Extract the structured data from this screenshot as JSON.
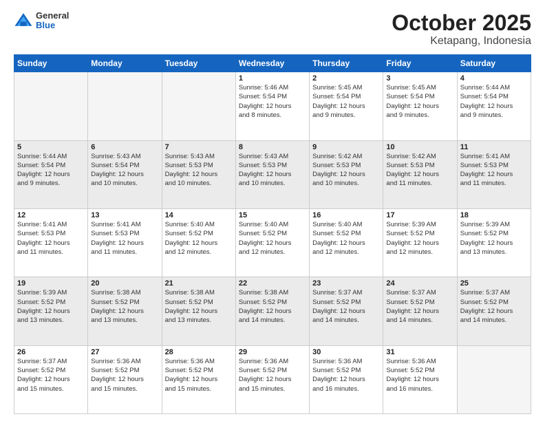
{
  "header": {
    "logo": {
      "general": "General",
      "blue": "Blue"
    },
    "month": "October 2025",
    "location": "Ketapang, Indonesia"
  },
  "weekdays": [
    "Sunday",
    "Monday",
    "Tuesday",
    "Wednesday",
    "Thursday",
    "Friday",
    "Saturday"
  ],
  "weeks": [
    {
      "shaded": false,
      "days": [
        {
          "date": "",
          "info": ""
        },
        {
          "date": "",
          "info": ""
        },
        {
          "date": "",
          "info": ""
        },
        {
          "date": "1",
          "info": "Sunrise: 5:46 AM\nSunset: 5:54 PM\nDaylight: 12 hours\nand 8 minutes."
        },
        {
          "date": "2",
          "info": "Sunrise: 5:45 AM\nSunset: 5:54 PM\nDaylight: 12 hours\nand 9 minutes."
        },
        {
          "date": "3",
          "info": "Sunrise: 5:45 AM\nSunset: 5:54 PM\nDaylight: 12 hours\nand 9 minutes."
        },
        {
          "date": "4",
          "info": "Sunrise: 5:44 AM\nSunset: 5:54 PM\nDaylight: 12 hours\nand 9 minutes."
        }
      ]
    },
    {
      "shaded": true,
      "days": [
        {
          "date": "5",
          "info": "Sunrise: 5:44 AM\nSunset: 5:54 PM\nDaylight: 12 hours\nand 9 minutes."
        },
        {
          "date": "6",
          "info": "Sunrise: 5:43 AM\nSunset: 5:54 PM\nDaylight: 12 hours\nand 10 minutes."
        },
        {
          "date": "7",
          "info": "Sunrise: 5:43 AM\nSunset: 5:53 PM\nDaylight: 12 hours\nand 10 minutes."
        },
        {
          "date": "8",
          "info": "Sunrise: 5:43 AM\nSunset: 5:53 PM\nDaylight: 12 hours\nand 10 minutes."
        },
        {
          "date": "9",
          "info": "Sunrise: 5:42 AM\nSunset: 5:53 PM\nDaylight: 12 hours\nand 10 minutes."
        },
        {
          "date": "10",
          "info": "Sunrise: 5:42 AM\nSunset: 5:53 PM\nDaylight: 12 hours\nand 11 minutes."
        },
        {
          "date": "11",
          "info": "Sunrise: 5:41 AM\nSunset: 5:53 PM\nDaylight: 12 hours\nand 11 minutes."
        }
      ]
    },
    {
      "shaded": false,
      "days": [
        {
          "date": "12",
          "info": "Sunrise: 5:41 AM\nSunset: 5:53 PM\nDaylight: 12 hours\nand 11 minutes."
        },
        {
          "date": "13",
          "info": "Sunrise: 5:41 AM\nSunset: 5:53 PM\nDaylight: 12 hours\nand 11 minutes."
        },
        {
          "date": "14",
          "info": "Sunrise: 5:40 AM\nSunset: 5:52 PM\nDaylight: 12 hours\nand 12 minutes."
        },
        {
          "date": "15",
          "info": "Sunrise: 5:40 AM\nSunset: 5:52 PM\nDaylight: 12 hours\nand 12 minutes."
        },
        {
          "date": "16",
          "info": "Sunrise: 5:40 AM\nSunset: 5:52 PM\nDaylight: 12 hours\nand 12 minutes."
        },
        {
          "date": "17",
          "info": "Sunrise: 5:39 AM\nSunset: 5:52 PM\nDaylight: 12 hours\nand 12 minutes."
        },
        {
          "date": "18",
          "info": "Sunrise: 5:39 AM\nSunset: 5:52 PM\nDaylight: 12 hours\nand 13 minutes."
        }
      ]
    },
    {
      "shaded": true,
      "days": [
        {
          "date": "19",
          "info": "Sunrise: 5:39 AM\nSunset: 5:52 PM\nDaylight: 12 hours\nand 13 minutes."
        },
        {
          "date": "20",
          "info": "Sunrise: 5:38 AM\nSunset: 5:52 PM\nDaylight: 12 hours\nand 13 minutes."
        },
        {
          "date": "21",
          "info": "Sunrise: 5:38 AM\nSunset: 5:52 PM\nDaylight: 12 hours\nand 13 minutes."
        },
        {
          "date": "22",
          "info": "Sunrise: 5:38 AM\nSunset: 5:52 PM\nDaylight: 12 hours\nand 14 minutes."
        },
        {
          "date": "23",
          "info": "Sunrise: 5:37 AM\nSunset: 5:52 PM\nDaylight: 12 hours\nand 14 minutes."
        },
        {
          "date": "24",
          "info": "Sunrise: 5:37 AM\nSunset: 5:52 PM\nDaylight: 12 hours\nand 14 minutes."
        },
        {
          "date": "25",
          "info": "Sunrise: 5:37 AM\nSunset: 5:52 PM\nDaylight: 12 hours\nand 14 minutes."
        }
      ]
    },
    {
      "shaded": false,
      "days": [
        {
          "date": "26",
          "info": "Sunrise: 5:37 AM\nSunset: 5:52 PM\nDaylight: 12 hours\nand 15 minutes."
        },
        {
          "date": "27",
          "info": "Sunrise: 5:36 AM\nSunset: 5:52 PM\nDaylight: 12 hours\nand 15 minutes."
        },
        {
          "date": "28",
          "info": "Sunrise: 5:36 AM\nSunset: 5:52 PM\nDaylight: 12 hours\nand 15 minutes."
        },
        {
          "date": "29",
          "info": "Sunrise: 5:36 AM\nSunset: 5:52 PM\nDaylight: 12 hours\nand 15 minutes."
        },
        {
          "date": "30",
          "info": "Sunrise: 5:36 AM\nSunset: 5:52 PM\nDaylight: 12 hours\nand 16 minutes."
        },
        {
          "date": "31",
          "info": "Sunrise: 5:36 AM\nSunset: 5:52 PM\nDaylight: 12 hours\nand 16 minutes."
        },
        {
          "date": "",
          "info": ""
        }
      ]
    }
  ]
}
